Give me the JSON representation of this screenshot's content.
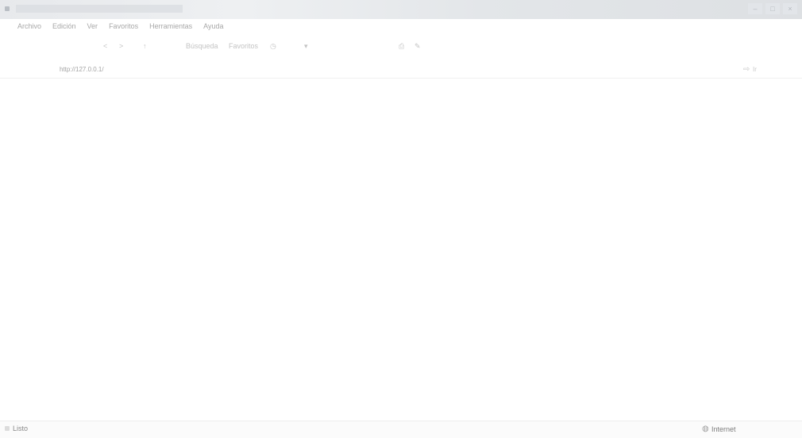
{
  "menu": {
    "items": [
      "Archivo",
      "Edición",
      "Ver",
      "Favoritos",
      "Herramientas",
      "Ayuda"
    ]
  },
  "toolbar": {
    "back_glyph": "<",
    "forward_glyph": ">",
    "arrow_glyph": "↑",
    "search_label": "Búsqueda",
    "favorites_label": "Favoritos",
    "history_glyph": "◷",
    "dropdown_glyph": "▾",
    "print_glyph": "⎙",
    "edit_glyph": "✎"
  },
  "address": {
    "text": "http://127.0.0.1/",
    "go_icon": "⇨",
    "go_label": "Ir"
  },
  "statusbar": {
    "status_text": "Listo",
    "zone_icon": "globe-icon",
    "zone_text": "Internet"
  }
}
